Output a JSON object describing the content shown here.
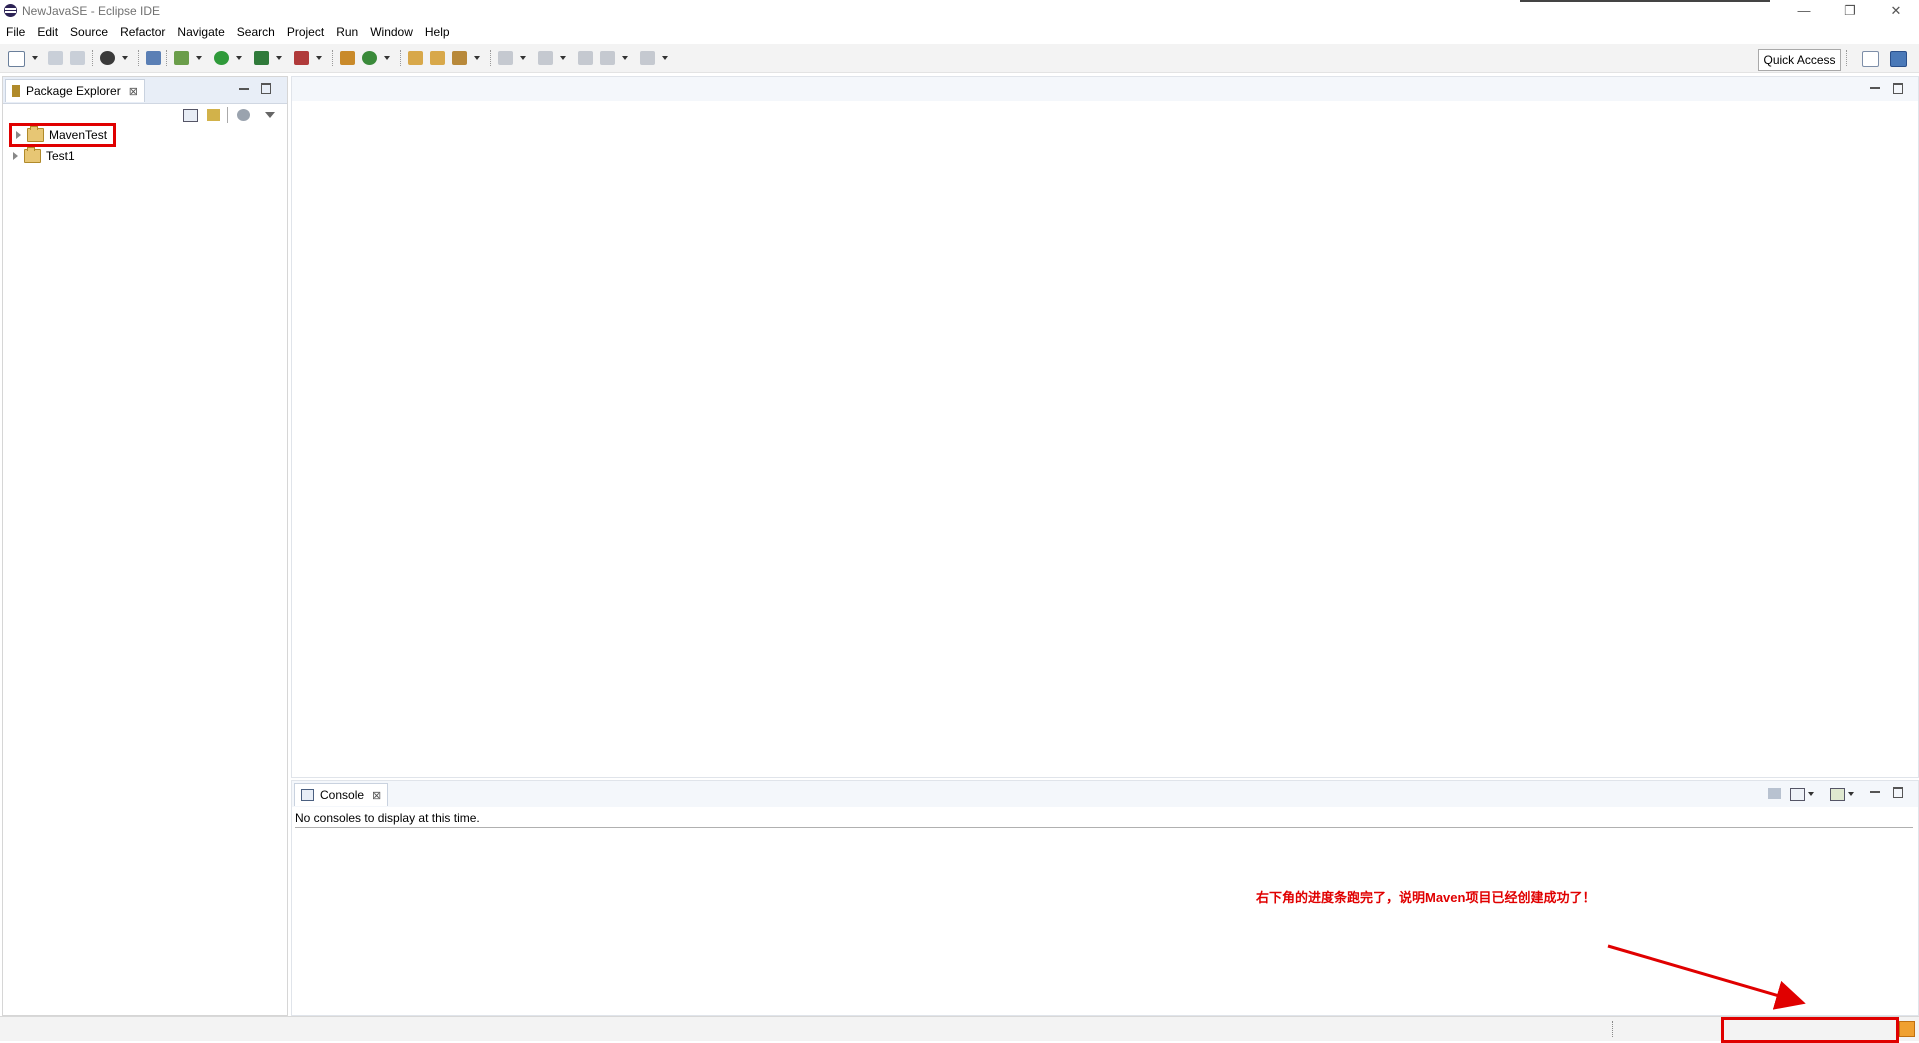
{
  "window": {
    "title": "NewJavaSE - Eclipse IDE",
    "minimize_glyph": "—",
    "restore_glyph": "❐",
    "close_glyph": "✕"
  },
  "menu": [
    "File",
    "Edit",
    "Source",
    "Refactor",
    "Navigate",
    "Search",
    "Project",
    "Run",
    "Window",
    "Help"
  ],
  "toolbar": {
    "quick_access_label": "Quick Access"
  },
  "package_explorer": {
    "tab_label": "Package Explorer",
    "close_glyph": "⊠",
    "items": [
      {
        "label": "MavenTest",
        "highlighted": true
      },
      {
        "label": "Test1",
        "highlighted": false
      }
    ]
  },
  "console": {
    "tab_label": "Console",
    "close_glyph": "⊠",
    "message": "No consoles to display at this time."
  },
  "annotation": {
    "text": "右下角的进度条跑完了，说明Maven项目已经创建成功了！",
    "color": "#e00000"
  },
  "colors": {
    "accent": "#e00000",
    "tab_strip": "#e8eef7"
  }
}
